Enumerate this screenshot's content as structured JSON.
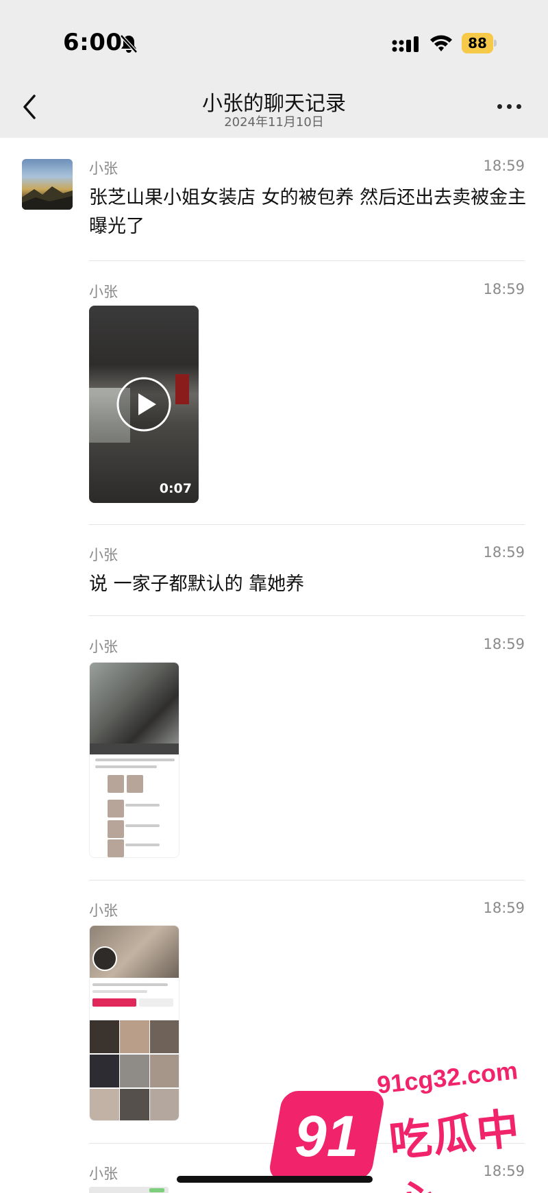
{
  "status_bar": {
    "time": "6:00",
    "battery": "88"
  },
  "header": {
    "title": "小张的聊天记录",
    "subtitle": "2024年11月10日"
  },
  "messages": [
    {
      "sender": "小张",
      "time": "18:59",
      "text": "张芝山果小姐女装店 女的被包养 然后还出去卖被金主曝光了"
    },
    {
      "sender": "小张",
      "time": "18:59",
      "video_duration": "0:07"
    },
    {
      "sender": "小张",
      "time": "18:59",
      "text": "说 一家子都默认的 靠她养"
    },
    {
      "sender": "小张",
      "time": "18:59"
    },
    {
      "sender": "小张",
      "time": "18:59"
    },
    {
      "sender": "小张",
      "time": "18:59"
    }
  ],
  "watermark": {
    "number": "91",
    "url": "91cg32.com",
    "label": "吃瓜中心"
  },
  "colors": {
    "header_bg": "#ededed",
    "accent": "#f0236b",
    "battery": "#f7c948"
  }
}
